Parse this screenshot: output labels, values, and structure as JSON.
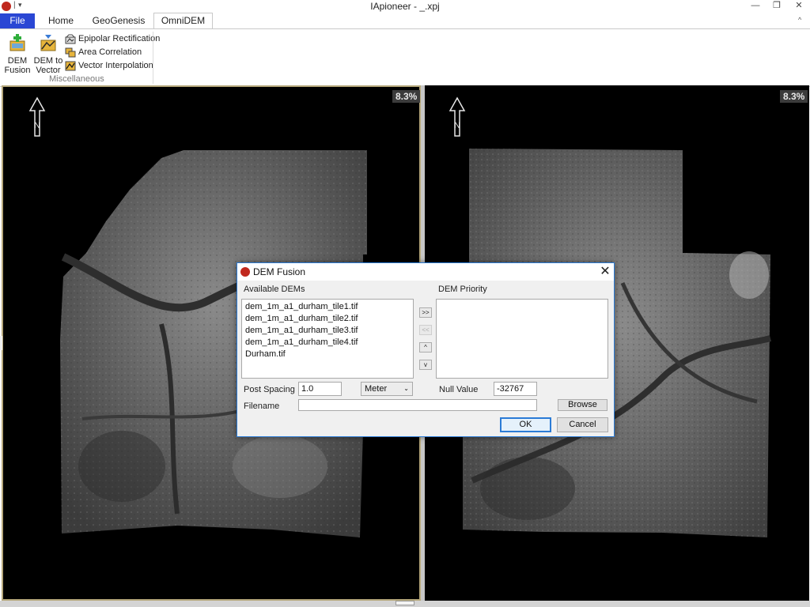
{
  "window": {
    "title": "IApioneer - _.xpj",
    "qa_separator": "|",
    "qa_dropdown": "▾",
    "minimize": "—",
    "restore": "❐",
    "close": "✕",
    "ribbon_collapse": "^"
  },
  "tabs": [
    {
      "label": "File"
    },
    {
      "label": "Home"
    },
    {
      "label": "GeoGenesis"
    },
    {
      "label": "OmniDEM"
    }
  ],
  "ribbon": {
    "dem_fusion_label": "DEM\nFusion",
    "dem_to_vector_label": "DEM to\nVector",
    "epipolar_label": "Epipolar Rectification",
    "area_correlation_label": "Area Correlation",
    "vector_interpolation_label": "Vector Interpolation",
    "group_label": "Miscellaneous"
  },
  "panes": {
    "left_zoom": "8.3%",
    "right_zoom": "8.3%",
    "north_label": "N"
  },
  "dialog": {
    "title": "DEM Fusion",
    "close": "✕",
    "available_label": "Available DEMs",
    "priority_label": "DEM Priority",
    "available_items": [
      "dem_1m_a1_durham_tile1.tif",
      "dem_1m_a1_durham_tile2.tif",
      "dem_1m_a1_durham_tile3.tif",
      "dem_1m_a1_durham_tile4.tif",
      "Durham.tif"
    ],
    "priority_items": [],
    "move_right": ">>",
    "move_left": "<<",
    "move_up": "^",
    "move_down": "v",
    "post_spacing_label": "Post Spacing",
    "post_spacing_value": "1.0",
    "unit_value": "Meter",
    "null_value_label": "Null Value",
    "null_value": "-32767",
    "filename_label": "Filename",
    "filename_value": "",
    "browse_label": "Browse",
    "ok_label": "OK",
    "cancel_label": "Cancel"
  }
}
